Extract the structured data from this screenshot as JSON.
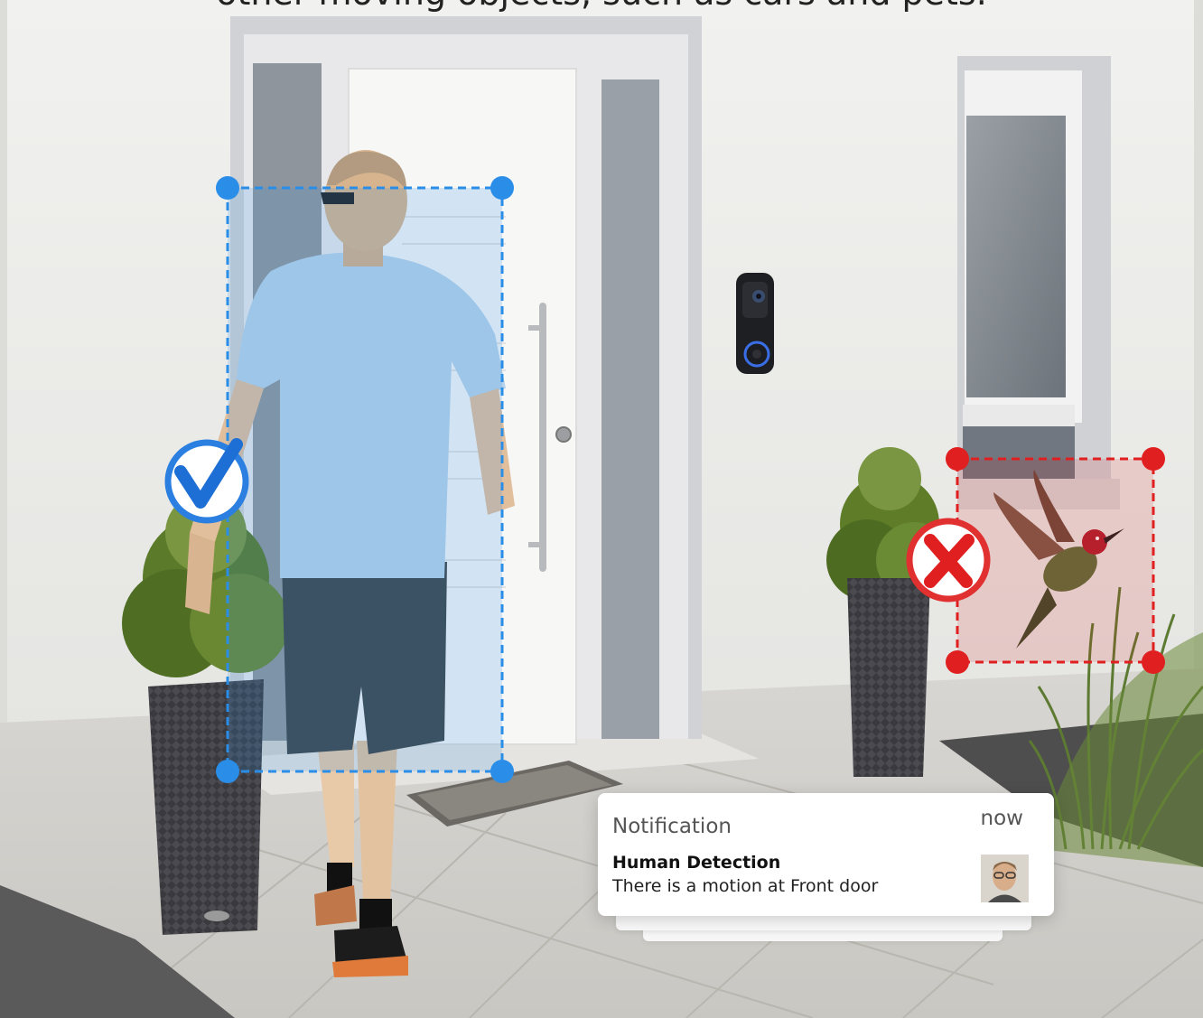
{
  "headline": "other moving objects, such as cars and pets.",
  "notification": {
    "app": "Notification",
    "time": "now",
    "title": "Human Detection",
    "body": "There is a motion at Front door"
  },
  "colors": {
    "human_box": "#2a8ee8",
    "ignore_box": "#e02020",
    "wall": "#eeeeec",
    "door": "#f5f5f5"
  },
  "icons": {
    "accept": "checkmark-icon",
    "reject": "cross-icon"
  }
}
